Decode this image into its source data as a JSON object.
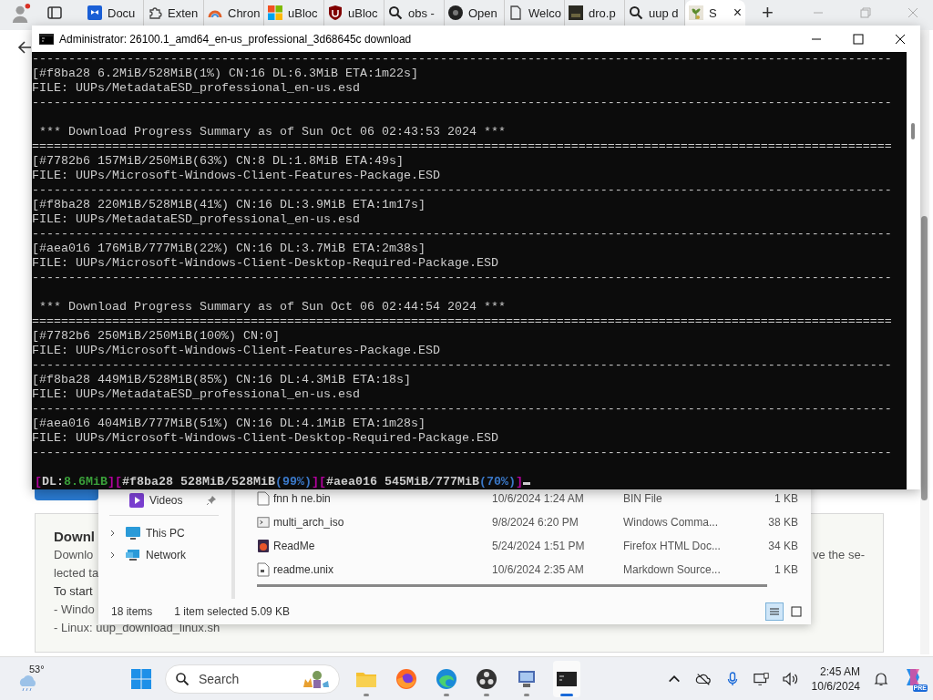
{
  "browser": {
    "tabs": [
      {
        "label": "Docu",
        "kind": "dropbox",
        "selected": false
      },
      {
        "label": "Exten",
        "kind": "puzzle",
        "selected": false
      },
      {
        "label": "Chron",
        "kind": "arc",
        "selected": false
      },
      {
        "label": "uBloc",
        "kind": "windows",
        "selected": false
      },
      {
        "label": "uBloc",
        "kind": "shield",
        "selected": false
      },
      {
        "label": "obs -",
        "kind": "search",
        "selected": false
      },
      {
        "label": "Open",
        "kind": "circle",
        "selected": false
      },
      {
        "label": "Welco",
        "kind": "page",
        "selected": false
      },
      {
        "label": "dro.p",
        "kind": "thumb",
        "selected": false
      },
      {
        "label": "uup d",
        "kind": "search",
        "selected": false
      },
      {
        "label": "S",
        "kind": "plant",
        "selected": true
      }
    ],
    "close_glyph": "×",
    "new_tab_glyph": "+"
  },
  "webpage": {
    "heading": "Downl",
    "lines": [
      "Downlo",
      "lected ta"
    ],
    "side_text": "ve the se-",
    "start_heading": "To start",
    "steps": [
      "- Windo",
      "- Linux: uup_download_linux.sh"
    ]
  },
  "console": {
    "title": "Administrator:  26100.1_amd64_en-us_professional_3d68645c download",
    "lines": [
      {
        "kind": "text",
        "text": "----------------------------------------------------------------------------------------------------------------------"
      },
      {
        "kind": "text",
        "text": "[#f8ba28 6.2MiB/528MiB(1%) CN:16 DL:6.3MiB ETA:1m22s]"
      },
      {
        "kind": "text",
        "text": "FILE: UUPs/MetadataESD_professional_en-us.esd"
      },
      {
        "kind": "text",
        "text": "----------------------------------------------------------------------------------------------------------------------"
      },
      {
        "kind": "blank"
      },
      {
        "kind": "text",
        "text": " *** Download Progress Summary as of Sun Oct 06 02:43:53 2024 ***"
      },
      {
        "kind": "text",
        "text": "======================================================================================================================"
      },
      {
        "kind": "text",
        "text": "[#7782b6 157MiB/250MiB(63%) CN:8 DL:1.8MiB ETA:49s]"
      },
      {
        "kind": "text",
        "text": "FILE: UUPs/Microsoft-Windows-Client-Features-Package.ESD"
      },
      {
        "kind": "text",
        "text": "----------------------------------------------------------------------------------------------------------------------"
      },
      {
        "kind": "text",
        "text": "[#f8ba28 220MiB/528MiB(41%) CN:16 DL:3.9MiB ETA:1m17s]"
      },
      {
        "kind": "text",
        "text": "FILE: UUPs/MetadataESD_professional_en-us.esd"
      },
      {
        "kind": "text",
        "text": "----------------------------------------------------------------------------------------------------------------------"
      },
      {
        "kind": "text",
        "text": "[#aea016 176MiB/777MiB(22%) CN:16 DL:3.7MiB ETA:2m38s]"
      },
      {
        "kind": "text",
        "text": "FILE: UUPs/Microsoft-Windows-Client-Desktop-Required-Package.ESD"
      },
      {
        "kind": "text",
        "text": "----------------------------------------------------------------------------------------------------------------------"
      },
      {
        "kind": "blank"
      },
      {
        "kind": "text",
        "text": " *** Download Progress Summary as of Sun Oct 06 02:44:54 2024 ***"
      },
      {
        "kind": "text",
        "text": "======================================================================================================================"
      },
      {
        "kind": "text",
        "text": "[#7782b6 250MiB/250MiB(100%) CN:0]"
      },
      {
        "kind": "text",
        "text": "FILE: UUPs/Microsoft-Windows-Client-Features-Package.ESD"
      },
      {
        "kind": "text",
        "text": "----------------------------------------------------------------------------------------------------------------------"
      },
      {
        "kind": "text",
        "text": "[#f8ba28 449MiB/528MiB(85%) CN:16 DL:4.3MiB ETA:18s]"
      },
      {
        "kind": "text",
        "text": "FILE: UUPs/MetadataESD_professional_en-us.esd"
      },
      {
        "kind": "text",
        "text": "----------------------------------------------------------------------------------------------------------------------"
      },
      {
        "kind": "text",
        "text": "[#aea016 404MiB/777MiB(51%) CN:16 DL:4.1MiB ETA:1m28s]"
      },
      {
        "kind": "text",
        "text": "FILE: UUPs/Microsoft-Windows-Client-Desktop-Required-Package.ESD"
      },
      {
        "kind": "text",
        "text": "----------------------------------------------------------------------------------------------------------------------"
      },
      {
        "kind": "blank"
      }
    ],
    "status_line": [
      {
        "text": "[",
        "color": "#b4009e"
      },
      {
        "text": "DL:",
        "color": "#cccccc"
      },
      {
        "text": "8.6MiB",
        "color": "#3aa03a"
      },
      {
        "text": "][",
        "color": "#b4009e"
      },
      {
        "text": "#f8ba28 528MiB/528MiB",
        "color": "#cccccc"
      },
      {
        "text": "(99%)",
        "color": "#3a78c8"
      },
      {
        "text": "][",
        "color": "#b4009e"
      },
      {
        "text": "#aea016 545MiB/777MiB",
        "color": "#cccccc"
      },
      {
        "text": "(70%)",
        "color": "#3a78c8"
      },
      {
        "text": "]",
        "color": "#b4009e"
      }
    ]
  },
  "explorer": {
    "nav": [
      {
        "label": "Videos",
        "kind": "videos"
      },
      {
        "label": "This PC",
        "kind": "pc"
      },
      {
        "label": "Network",
        "kind": "network"
      }
    ],
    "files": [
      {
        "name": "fnn h ne.bin",
        "kind": "blank",
        "date": "10/6/2024 1:24 AM",
        "type": "BIN File",
        "size": "1 KB"
      },
      {
        "name": "multi_arch_iso",
        "kind": "script",
        "date": "9/8/2024 6:20 PM",
        "type": "Windows Comma...",
        "size": "38 KB"
      },
      {
        "name": "ReadMe",
        "kind": "html",
        "date": "5/24/2024 1:51 PM",
        "type": "Firefox HTML Doc...",
        "size": "34 KB"
      },
      {
        "name": "readme.unix",
        "kind": "text",
        "date": "10/6/2024 2:35 AM",
        "type": "Markdown Source...",
        "size": "1 KB"
      }
    ],
    "status": {
      "count": "18 items",
      "selection": "1 item selected  5.09 KB"
    },
    "views": [
      {
        "kind": "details",
        "selected": true
      },
      {
        "kind": "tiles",
        "selected": false
      }
    ]
  },
  "taskbar": {
    "weather": "53°",
    "search_placeholder": "Search",
    "apps": [
      {
        "kind": "folder",
        "running": true,
        "selected": false
      },
      {
        "kind": "firefox",
        "running": false,
        "selected": false
      },
      {
        "kind": "edge",
        "running": true,
        "selected": false
      },
      {
        "kind": "obs",
        "running": true,
        "selected": false
      },
      {
        "kind": "monitor",
        "running": true,
        "selected": false
      },
      {
        "kind": "terminal",
        "running": true,
        "selected": true
      }
    ],
    "time": "2:45 AM",
    "date": "10/6/2024",
    "copilot_badge": "PRE"
  }
}
